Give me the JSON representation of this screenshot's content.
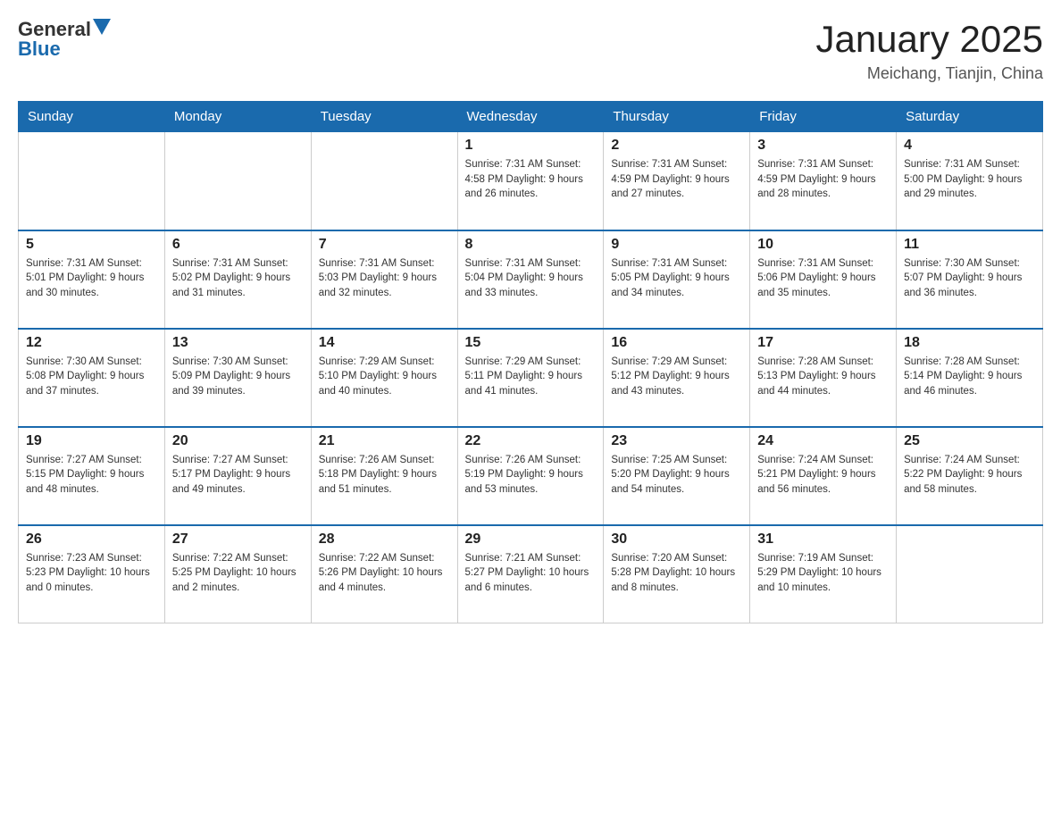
{
  "header": {
    "logo_general": "General",
    "logo_blue": "Blue",
    "title": "January 2025",
    "subtitle": "Meichang, Tianjin, China"
  },
  "days_of_week": [
    "Sunday",
    "Monday",
    "Tuesday",
    "Wednesday",
    "Thursday",
    "Friday",
    "Saturday"
  ],
  "weeks": [
    [
      {
        "day": "",
        "info": ""
      },
      {
        "day": "",
        "info": ""
      },
      {
        "day": "",
        "info": ""
      },
      {
        "day": "1",
        "info": "Sunrise: 7:31 AM\nSunset: 4:58 PM\nDaylight: 9 hours\nand 26 minutes."
      },
      {
        "day": "2",
        "info": "Sunrise: 7:31 AM\nSunset: 4:59 PM\nDaylight: 9 hours\nand 27 minutes."
      },
      {
        "day": "3",
        "info": "Sunrise: 7:31 AM\nSunset: 4:59 PM\nDaylight: 9 hours\nand 28 minutes."
      },
      {
        "day": "4",
        "info": "Sunrise: 7:31 AM\nSunset: 5:00 PM\nDaylight: 9 hours\nand 29 minutes."
      }
    ],
    [
      {
        "day": "5",
        "info": "Sunrise: 7:31 AM\nSunset: 5:01 PM\nDaylight: 9 hours\nand 30 minutes."
      },
      {
        "day": "6",
        "info": "Sunrise: 7:31 AM\nSunset: 5:02 PM\nDaylight: 9 hours\nand 31 minutes."
      },
      {
        "day": "7",
        "info": "Sunrise: 7:31 AM\nSunset: 5:03 PM\nDaylight: 9 hours\nand 32 minutes."
      },
      {
        "day": "8",
        "info": "Sunrise: 7:31 AM\nSunset: 5:04 PM\nDaylight: 9 hours\nand 33 minutes."
      },
      {
        "day": "9",
        "info": "Sunrise: 7:31 AM\nSunset: 5:05 PM\nDaylight: 9 hours\nand 34 minutes."
      },
      {
        "day": "10",
        "info": "Sunrise: 7:31 AM\nSunset: 5:06 PM\nDaylight: 9 hours\nand 35 minutes."
      },
      {
        "day": "11",
        "info": "Sunrise: 7:30 AM\nSunset: 5:07 PM\nDaylight: 9 hours\nand 36 minutes."
      }
    ],
    [
      {
        "day": "12",
        "info": "Sunrise: 7:30 AM\nSunset: 5:08 PM\nDaylight: 9 hours\nand 37 minutes."
      },
      {
        "day": "13",
        "info": "Sunrise: 7:30 AM\nSunset: 5:09 PM\nDaylight: 9 hours\nand 39 minutes."
      },
      {
        "day": "14",
        "info": "Sunrise: 7:29 AM\nSunset: 5:10 PM\nDaylight: 9 hours\nand 40 minutes."
      },
      {
        "day": "15",
        "info": "Sunrise: 7:29 AM\nSunset: 5:11 PM\nDaylight: 9 hours\nand 41 minutes."
      },
      {
        "day": "16",
        "info": "Sunrise: 7:29 AM\nSunset: 5:12 PM\nDaylight: 9 hours\nand 43 minutes."
      },
      {
        "day": "17",
        "info": "Sunrise: 7:28 AM\nSunset: 5:13 PM\nDaylight: 9 hours\nand 44 minutes."
      },
      {
        "day": "18",
        "info": "Sunrise: 7:28 AM\nSunset: 5:14 PM\nDaylight: 9 hours\nand 46 minutes."
      }
    ],
    [
      {
        "day": "19",
        "info": "Sunrise: 7:27 AM\nSunset: 5:15 PM\nDaylight: 9 hours\nand 48 minutes."
      },
      {
        "day": "20",
        "info": "Sunrise: 7:27 AM\nSunset: 5:17 PM\nDaylight: 9 hours\nand 49 minutes."
      },
      {
        "day": "21",
        "info": "Sunrise: 7:26 AM\nSunset: 5:18 PM\nDaylight: 9 hours\nand 51 minutes."
      },
      {
        "day": "22",
        "info": "Sunrise: 7:26 AM\nSunset: 5:19 PM\nDaylight: 9 hours\nand 53 minutes."
      },
      {
        "day": "23",
        "info": "Sunrise: 7:25 AM\nSunset: 5:20 PM\nDaylight: 9 hours\nand 54 minutes."
      },
      {
        "day": "24",
        "info": "Sunrise: 7:24 AM\nSunset: 5:21 PM\nDaylight: 9 hours\nand 56 minutes."
      },
      {
        "day": "25",
        "info": "Sunrise: 7:24 AM\nSunset: 5:22 PM\nDaylight: 9 hours\nand 58 minutes."
      }
    ],
    [
      {
        "day": "26",
        "info": "Sunrise: 7:23 AM\nSunset: 5:23 PM\nDaylight: 10 hours\nand 0 minutes."
      },
      {
        "day": "27",
        "info": "Sunrise: 7:22 AM\nSunset: 5:25 PM\nDaylight: 10 hours\nand 2 minutes."
      },
      {
        "day": "28",
        "info": "Sunrise: 7:22 AM\nSunset: 5:26 PM\nDaylight: 10 hours\nand 4 minutes."
      },
      {
        "day": "29",
        "info": "Sunrise: 7:21 AM\nSunset: 5:27 PM\nDaylight: 10 hours\nand 6 minutes."
      },
      {
        "day": "30",
        "info": "Sunrise: 7:20 AM\nSunset: 5:28 PM\nDaylight: 10 hours\nand 8 minutes."
      },
      {
        "day": "31",
        "info": "Sunrise: 7:19 AM\nSunset: 5:29 PM\nDaylight: 10 hours\nand 10 minutes."
      },
      {
        "day": "",
        "info": ""
      }
    ]
  ]
}
